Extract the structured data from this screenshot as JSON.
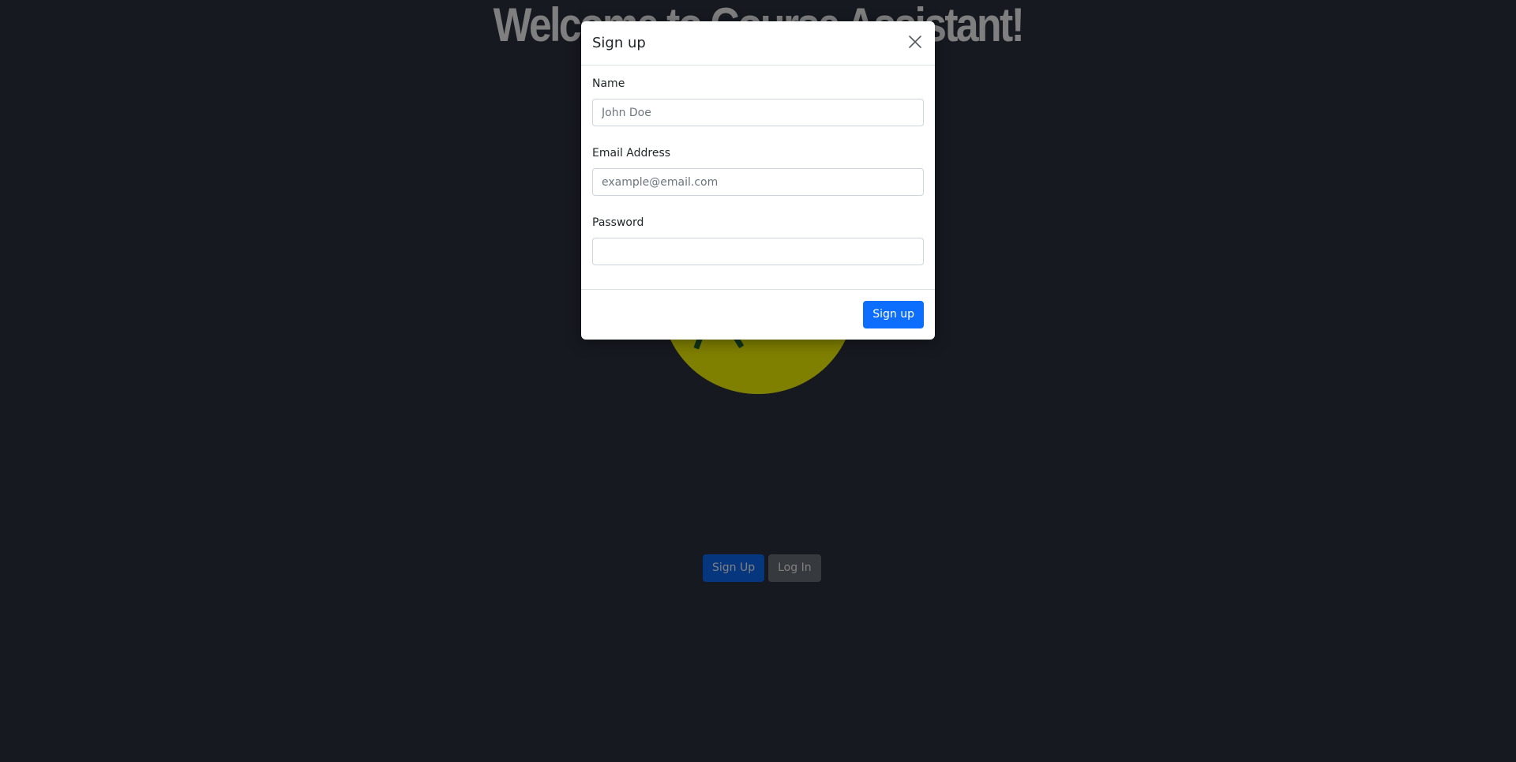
{
  "page": {
    "title": "Welcome to Course Assistant!",
    "buttons": {
      "signup_label": "Sign Up",
      "login_label": "Log In"
    }
  },
  "modal": {
    "title": "Sign up",
    "close_icon": "close-icon",
    "fields": {
      "name": {
        "label": "Name",
        "placeholder": "John Doe",
        "value": ""
      },
      "email": {
        "label": "Email Address",
        "placeholder": "example@email.com",
        "value": ""
      },
      "password": {
        "label": "Password",
        "placeholder": "",
        "value": ""
      }
    },
    "submit_label": "Sign up"
  },
  "colors": {
    "page_background": "#161a23",
    "primary": "#0d6efd",
    "secondary": "#6c757d",
    "mascot": "#ffff00"
  }
}
